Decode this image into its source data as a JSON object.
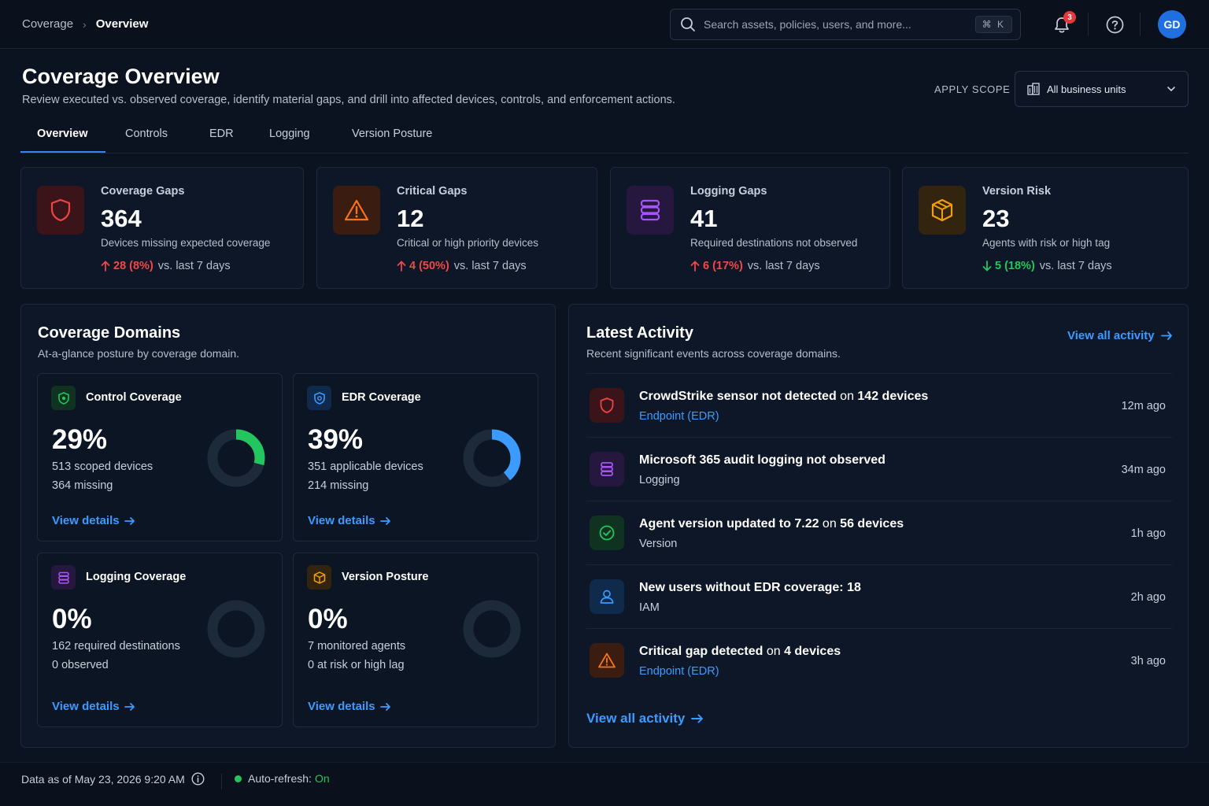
{
  "breadcrumb": {
    "parent": "Coverage",
    "current": "Overview"
  },
  "search": {
    "placeholder": "Search assets, policies, users, and more...",
    "shortcut": "⌘ K"
  },
  "notifications": {
    "count": "3"
  },
  "user": {
    "initials": "GD"
  },
  "header": {
    "title": "Coverage Overview",
    "subtitle": "Review executed vs. observed coverage, identify material gaps, and drill into affected devices, controls, and enforcement actions.",
    "scope_label": "APPLY SCOPE",
    "scope_value": "All business units"
  },
  "tabs": [
    {
      "label": "Overview",
      "active": true
    },
    {
      "label": "Controls"
    },
    {
      "label": "EDR"
    },
    {
      "label": "Logging"
    },
    {
      "label": "Version Posture"
    }
  ],
  "kpis": [
    {
      "label": "Coverage Gaps",
      "value": "364",
      "desc": "Devices missing expected coverage",
      "delta": "28 (8%)",
      "direction": "up",
      "compare": "vs. last 7 days",
      "icon": "shield-icon",
      "color": "#ef4444"
    },
    {
      "label": "Critical Gaps",
      "value": "12",
      "desc": "Critical or high priority devices",
      "delta": "4 (50%)",
      "direction": "up",
      "compare": "vs. last 7 days",
      "icon": "warning-icon",
      "color": "#f97316"
    },
    {
      "label": "Logging Gaps",
      "value": "41",
      "desc": "Required destinations not observed",
      "delta": "6 (17%)",
      "direction": "up",
      "compare": "vs. last 7 days",
      "icon": "database-icon",
      "color": "#a855f7"
    },
    {
      "label": "Version Risk",
      "value": "23",
      "desc": "Agents with risk or high tag",
      "delta": "5 (18%)",
      "direction": "down",
      "compare": "vs. last 7 days",
      "icon": "package-icon",
      "color": "#f59e0b"
    }
  ],
  "domains": {
    "title": "Coverage Domains",
    "subtitle": "At-a-glance posture by coverage domain.",
    "cards": [
      {
        "title": "Control Coverage",
        "percent": "29%",
        "line1": "513 scoped devices",
        "line2": "364 missing",
        "link": "View details",
        "fraction": 0.29,
        "color": "#22c55e"
      },
      {
        "title": "EDR Coverage",
        "percent": "39%",
        "line1": "351 applicable devices",
        "line2": "214 missing",
        "link": "View details",
        "fraction": 0.39,
        "color": "#3b9bff"
      },
      {
        "title": "Logging Coverage",
        "percent": "0%",
        "line1": "162 required destinations",
        "line2": "0 observed",
        "link": "View details",
        "fraction": 0,
        "color": "#a855f7"
      },
      {
        "title": "Version Posture",
        "percent": "0%",
        "line1": "7 monitored agents",
        "line2": "0 at risk or high lag",
        "link": "View details",
        "fraction": 0,
        "color": "#f59e0b"
      }
    ]
  },
  "activity": {
    "title": "Latest Activity",
    "subtitle": "Recent significant events across coverage domains.",
    "view_all": "View all activity",
    "items": [
      {
        "pre": "CrowdStrike sensor not detected",
        "mid": " on ",
        "post": "142 devices",
        "category": "Endpoint (EDR)",
        "time": "12m ago"
      },
      {
        "pre": "Microsoft 365 audit logging not observed",
        "mid": "",
        "post": "",
        "category": "Logging",
        "time": "34m ago"
      },
      {
        "pre": "Agent version updated to 7.22",
        "mid": " on ",
        "post": "56 devices",
        "category": "Version",
        "time": "1h ago"
      },
      {
        "pre": "New users without EDR coverage: 18",
        "mid": "",
        "post": "",
        "category": "IAM",
        "time": "2h ago"
      },
      {
        "pre": "Critical gap detected",
        "mid": " on ",
        "post": "4 devices",
        "category": "Endpoint (EDR)",
        "time": "3h ago"
      }
    ]
  },
  "footer": {
    "data_as_of": "Data as of May 23, 2026 9:20 AM",
    "refresh_label": "Auto-refresh:",
    "refresh_value": "On"
  }
}
